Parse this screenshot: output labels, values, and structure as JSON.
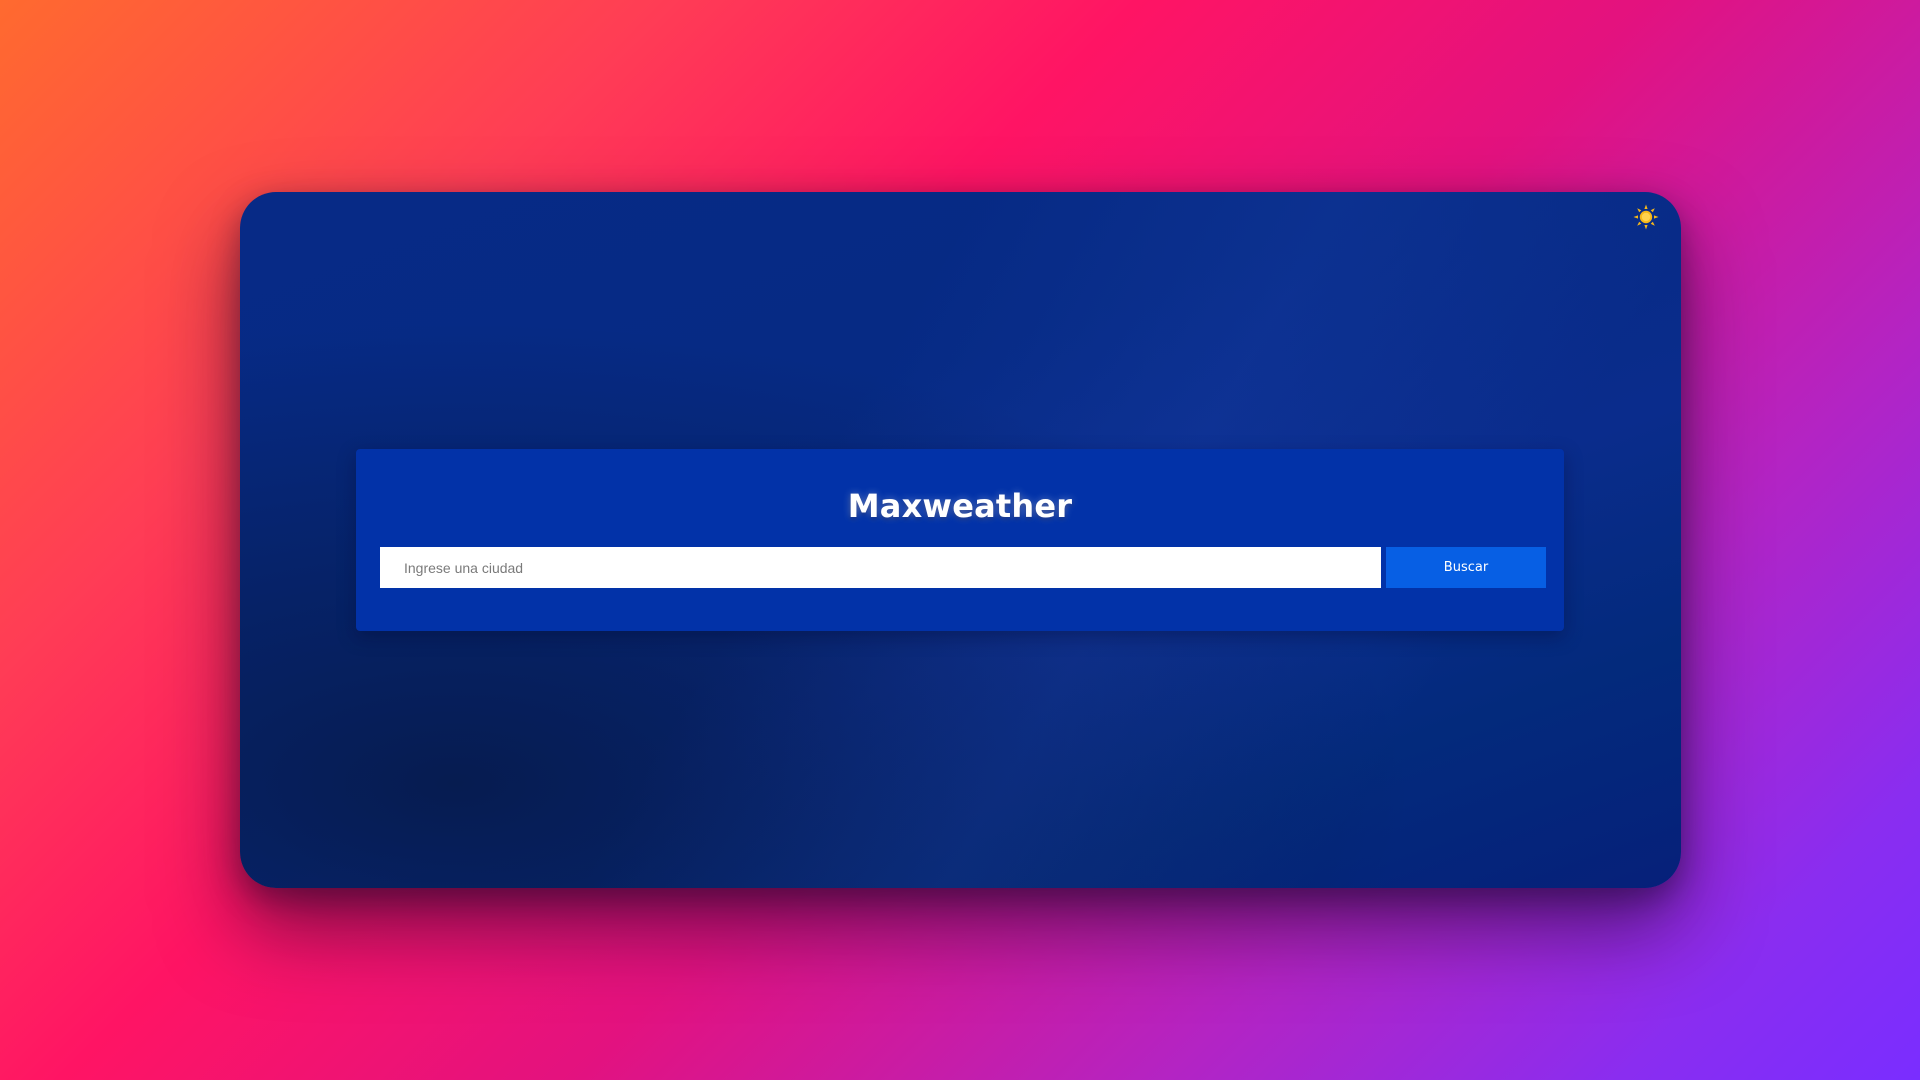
{
  "app": {
    "title": "Maxweather"
  },
  "search": {
    "placeholder": "Ingrese una ciudad",
    "value": "",
    "button_label": "Buscar"
  },
  "theme_toggle": {
    "icon": "sun-icon",
    "color": "#f6b81a"
  },
  "colors": {
    "window_background": "#062a84",
    "card_background": "#0232a8",
    "button_background": "#075fe4",
    "page_gradient": [
      "#ff6a2f",
      "#ff1464",
      "#b324c4",
      "#7a2dff"
    ]
  }
}
